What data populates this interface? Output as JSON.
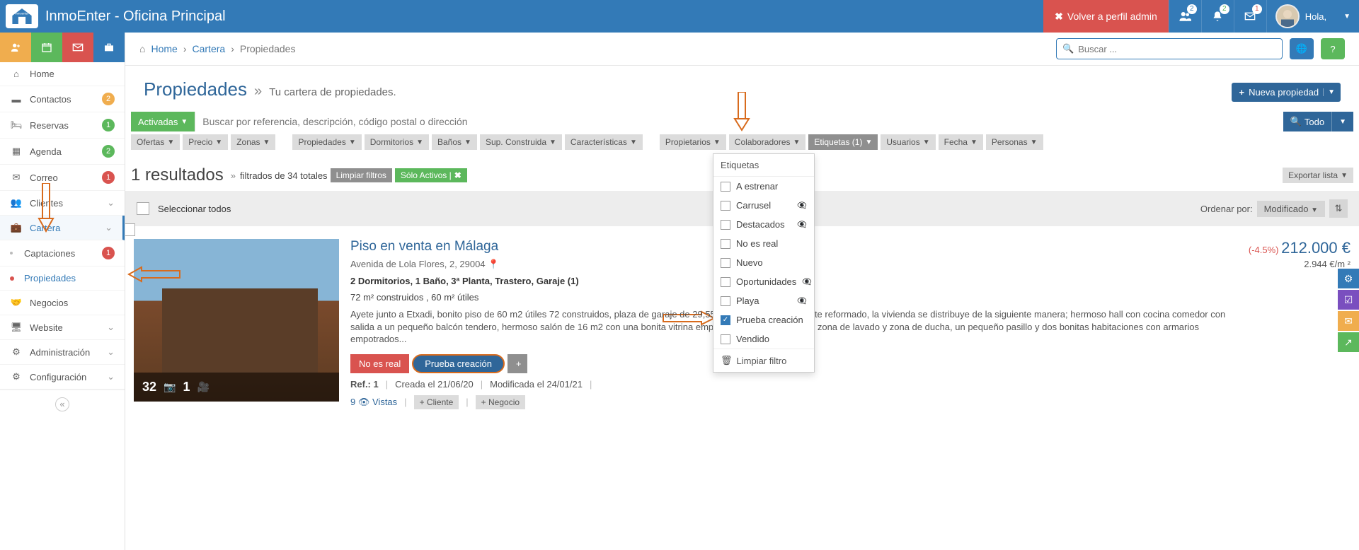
{
  "topnav": {
    "app_title": "InmoEnter - Oficina Principal",
    "back_to_admin": "Volver a perfil admin",
    "badges": {
      "users": "2",
      "bell": "2",
      "mail": "1"
    },
    "user_greeting": "Hola,"
  },
  "breadcrumb": {
    "home": "Home",
    "cartera": "Cartera",
    "propiedades": "Propiedades"
  },
  "search": {
    "placeholder": "Buscar ..."
  },
  "sidebar": {
    "home": "Home",
    "contactos": {
      "label": "Contactos",
      "badge": "2"
    },
    "reservas": {
      "label": "Reservas",
      "badge": "1"
    },
    "agenda": {
      "label": "Agenda",
      "badge": "2"
    },
    "correo": {
      "label": "Correo",
      "badge": "1"
    },
    "clientes": "Clientes",
    "cartera": "Cartera",
    "captaciones": {
      "label": "Captaciones",
      "badge": "1"
    },
    "propiedades": "Propiedades",
    "negocios": "Negocios",
    "website": "Website",
    "administracion": "Administración",
    "configuracion": "Configuración"
  },
  "page": {
    "title": "Propiedades",
    "subtitle": "Tu cartera de propiedades.",
    "new_btn": "Nueva propiedad"
  },
  "filters": {
    "activadas": "Activadas",
    "search_placeholder": "Buscar por referencia, descripción, código postal o dirección",
    "todo": "Todo",
    "chips": {
      "ofertas": "Ofertas",
      "precio": "Precio",
      "zonas": "Zonas",
      "propiedades": "Propiedades",
      "dormitorios": "Dormitorios",
      "banos": "Baños",
      "sup": "Sup. Construida",
      "caracteristicas": "Características",
      "propietarios": "Propietarios",
      "colaboradores": "Colaboradores",
      "etiquetas": "Etiquetas (1)",
      "usuarios": "Usuarios",
      "fecha": "Fecha",
      "personas": "Personas"
    }
  },
  "etiquetas_dd": {
    "header": "Etiquetas",
    "items": [
      {
        "label": "A estrenar",
        "hidden": false,
        "checked": false
      },
      {
        "label": "Carrusel",
        "hidden": true,
        "checked": false
      },
      {
        "label": "Destacados",
        "hidden": true,
        "checked": false
      },
      {
        "label": "No es real",
        "hidden": false,
        "checked": false
      },
      {
        "label": "Nuevo",
        "hidden": false,
        "checked": false
      },
      {
        "label": "Oportunidades",
        "hidden": true,
        "checked": false
      },
      {
        "label": "Playa",
        "hidden": true,
        "checked": false
      },
      {
        "label": "Prueba creación",
        "hidden": false,
        "checked": true
      },
      {
        "label": "Vendido",
        "hidden": false,
        "checked": false
      }
    ],
    "clear": "Limpiar filtro"
  },
  "results": {
    "count": "1 resultados",
    "filtered": "filtrados de 34 totales",
    "clear_filters": "Limpiar filtros",
    "solo_activos": "Sólo Activos |",
    "export": "Exportar lista",
    "select_all": "Seleccionar todos",
    "order_by": "Ordenar por:",
    "order_val": "Modificado"
  },
  "listing": {
    "photos": "32",
    "videos": "1",
    "title": "Piso en venta en Málaga",
    "address": "Avenida de Lola Flores, 2, 29004",
    "features": "2 Dormitorios, 1 Baño, 3ª Planta, Trastero, Garaje (1)",
    "size_built": "72 m² construidos , 60 m² útiles",
    "description": "Ayete junto a Etxadi, bonito piso de 60 m2 útiles 72 construidos, plaza de garaje de 29,55 m2 útiles; piso totalmente reformado, la vivienda se distribuye de la siguiente manera; hermoso hall con cocina comedor con salida a un pequeño balcón tendero, hermoso salón de 16 m2 con una bonita vitrina empotrada en dos ambientes zona de lavado y zona de ducha, un pequeño pasillo y dos bonitas habitaciones con armarios empotrados...",
    "tag_red": "No es real",
    "tag_blue": "Prueba creación",
    "ref_lbl": "Ref.:",
    "ref_val": "1",
    "created": "Creada el 21/06/20",
    "modified": "Modificada el 24/01/21",
    "views": "9",
    "views_lbl": "Vistas",
    "add_cliente": "Cliente",
    "add_negocio": "Negocio",
    "discount": "(-4.5%)",
    "price": "212.000 €",
    "ppm": "2.944 €/m ²"
  }
}
